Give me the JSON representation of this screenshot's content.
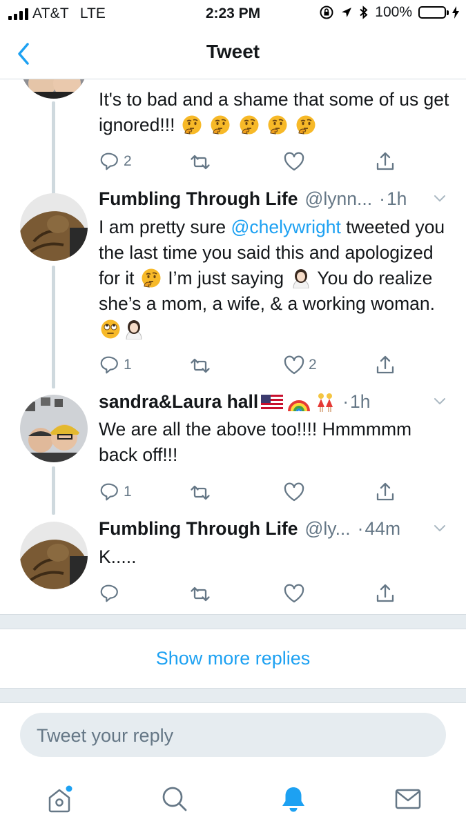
{
  "status_bar": {
    "carrier": "AT&T",
    "network": "LTE",
    "time": "2:23 PM",
    "battery": "100%",
    "icons": [
      "signal-icon",
      "lock-rotation-icon",
      "location-arrow-icon",
      "bluetooth-icon",
      "battery-icon",
      "charging-bolt-icon"
    ]
  },
  "nav": {
    "title": "Tweet",
    "back_icon": "chevron-left-icon"
  },
  "tweets": [
    {
      "text": "It's to bad and a shame that some of us get ignored!!!",
      "emoji": [
        "thinking-face",
        "thinking-face",
        "thinking-face",
        "thinking-face",
        "thinking-face"
      ],
      "replies": "2",
      "retweets": "",
      "likes": ""
    },
    {
      "name": "Fumbling Through Life",
      "handle": "@lynn...",
      "time": "1h",
      "text_parts": {
        "a": "I am pretty sure ",
        "mention": "@chelywright",
        "b": " tweeted you the last time you said this and apologized for it ",
        "c": " I’m just saying ",
        "d": " You do realize she’s a mom, a wife, & a working woman. "
      },
      "emoji": [
        "thinking-face",
        "woman-shrugging",
        "face-with-rolling-eyes",
        "woman-facepalming"
      ],
      "replies": "1",
      "retweets": "",
      "likes": "2"
    },
    {
      "name": "sandra&Laura hall",
      "name_emoji": [
        "us-flag",
        "rainbow",
        "two-women-holding-hands"
      ],
      "time": "1h",
      "text": "We are all the above too!!!! Hmmmmm back off!!!",
      "replies": "1",
      "retweets": "",
      "likes": ""
    },
    {
      "name": "Fumbling Through Life",
      "handle": "@ly...",
      "time": "44m",
      "text": "K.....",
      "replies": "",
      "retweets": "",
      "likes": ""
    }
  ],
  "dot": "·",
  "show_more": "Show more replies",
  "reply": {
    "placeholder": "Tweet your reply"
  },
  "tabs": [
    "home-icon",
    "search-icon",
    "notifications-bell-icon",
    "messages-envelope-icon"
  ],
  "colors": {
    "accent": "#1da1f2",
    "muted": "#657786",
    "separator": "#e6ecf0",
    "battery": "#4cd964",
    "thinking_emoji": "#f7b928"
  }
}
